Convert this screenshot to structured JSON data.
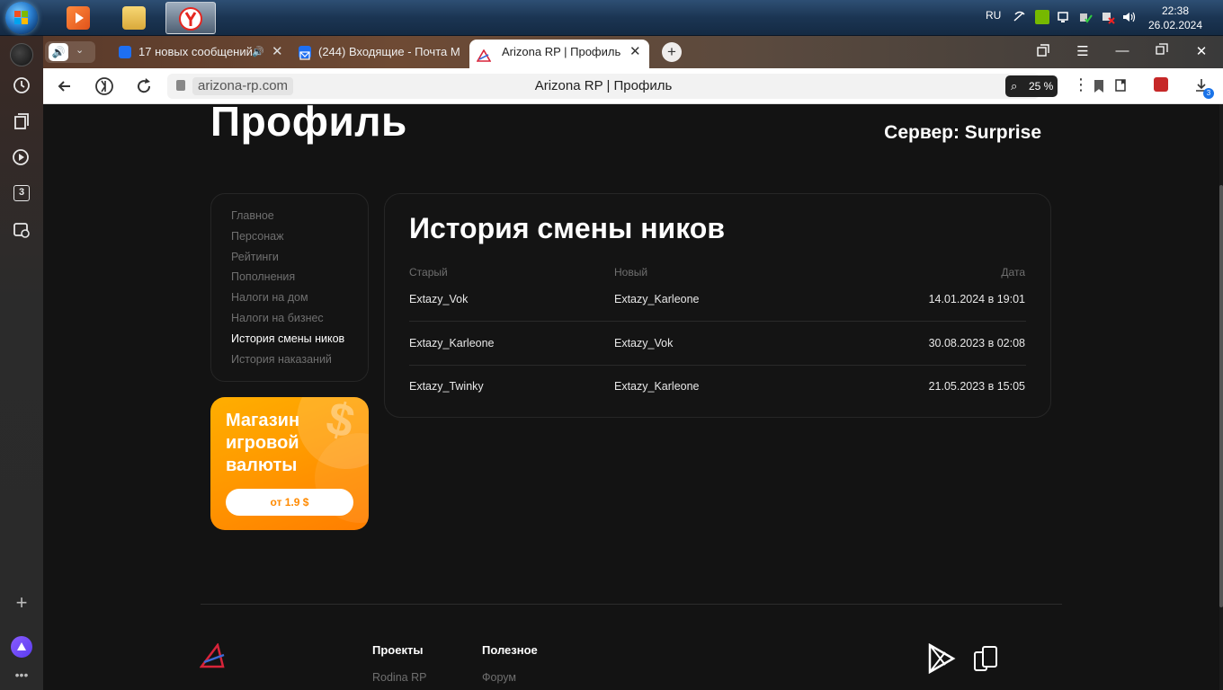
{
  "taskbar": {
    "lang": "RU",
    "time": "22:38",
    "date": "26.02.2024"
  },
  "browser": {
    "tabs": [
      {
        "title": "17 новых сообщений",
        "active": false
      },
      {
        "title": "(244) Входящие - Почта М",
        "active": false
      },
      {
        "title": "Arizona RP | Профиль",
        "active": true
      }
    ],
    "address": {
      "domain": "arizona-rp.com",
      "page_title": "Arizona RP | Профиль"
    },
    "zoom": "25 %",
    "downloads_badge": "3"
  },
  "sidepanel": {
    "tab_count": "3"
  },
  "page": {
    "title": "Профиль",
    "server": "Сервер: Surprise",
    "menu": [
      {
        "label": "Главное",
        "active": false
      },
      {
        "label": "Персонаж",
        "active": false
      },
      {
        "label": "Рейтинги",
        "active": false
      },
      {
        "label": "Пополнения",
        "active": false
      },
      {
        "label": "Налоги на дом",
        "active": false
      },
      {
        "label": "Налоги на бизнес",
        "active": false
      },
      {
        "label": "История смены ников",
        "active": true
      },
      {
        "label": "История наказаний",
        "active": false
      }
    ],
    "shop": {
      "title": "Магазин игровой валюты",
      "button": "от 1.9 $",
      "symbol": "$"
    },
    "history": {
      "title": "История смены ников",
      "columns": {
        "old": "Старый",
        "new": "Новый",
        "date": "Дата"
      },
      "rows": [
        {
          "old": "Extazy_Vok",
          "new": "Extazy_Karleone",
          "date": "14.01.2024 в 19:01"
        },
        {
          "old": "Extazy_Karleone",
          "new": "Extazy_Vok",
          "date": "30.08.2023 в 02:08"
        },
        {
          "old": "Extazy_Twinky",
          "new": "Extazy_Karleone",
          "date": "21.05.2023 в 15:05"
        }
      ]
    },
    "footer": {
      "projects_head": "Проекты",
      "useful_head": "Полезное",
      "projects_link": "Rodina RP",
      "useful_link": "Форум"
    }
  },
  "colors": {
    "accent_orange": "#ff9a00",
    "page_bg": "#131313",
    "card_border": "#262626"
  }
}
